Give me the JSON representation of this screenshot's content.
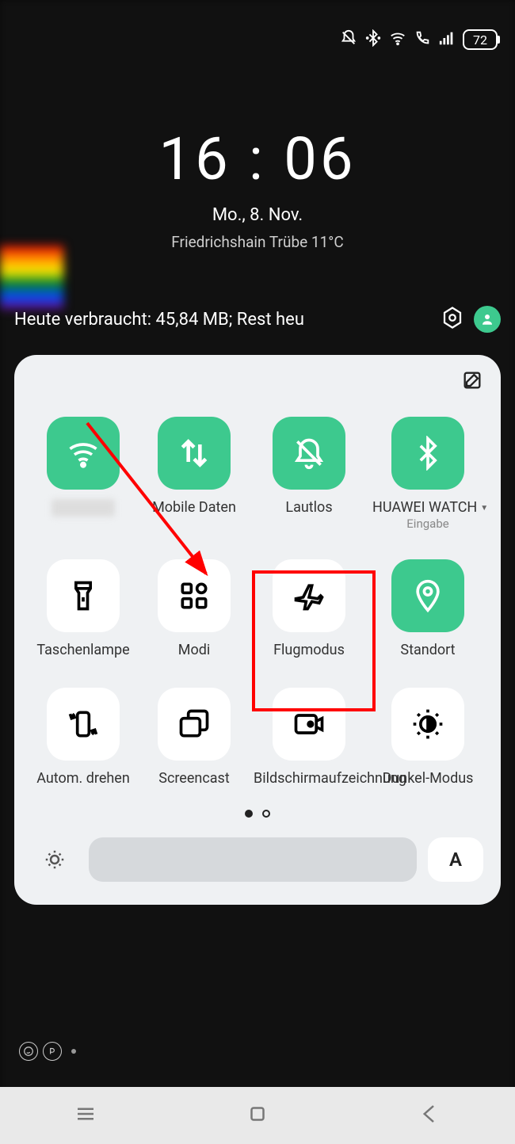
{
  "status": {
    "battery": "72"
  },
  "clock": {
    "time": "16 : 06",
    "date": "Mo., 8. Nov.",
    "weather": "Friedrichshain Trübe 11°C"
  },
  "usage": {
    "text": "Heute verbraucht: 45,84 MB; Rest heu"
  },
  "tiles": {
    "wifi": {
      "label": ""
    },
    "mobiledata": {
      "label": "Mobile Daten"
    },
    "mute": {
      "label": "Lautlos"
    },
    "bluetooth": {
      "label": "HUAWEI WATCH",
      "sub": "Eingabe"
    },
    "flashlight": {
      "label": "Taschenlampe"
    },
    "modes": {
      "label": "Modi"
    },
    "airplane": {
      "label": "Flugmodus"
    },
    "location": {
      "label": "Standort"
    },
    "autorotate": {
      "label": "Autom. drehen"
    },
    "screencast": {
      "label": "Screencast"
    },
    "screenrecord": {
      "label": "Bildschirmaufzeichnung"
    },
    "darkmode": {
      "label": "Dunkel-Modus"
    }
  },
  "brightness": {
    "auto": "A"
  }
}
